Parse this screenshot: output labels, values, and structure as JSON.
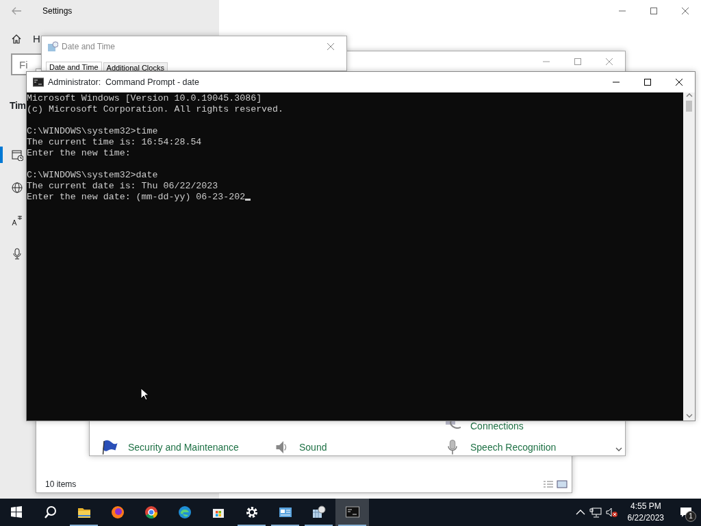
{
  "settings_window": {
    "title": "Settings",
    "home_label": "H",
    "search_placeholder": "Fi",
    "section_heading": "Tim",
    "sidebar_items": [
      {
        "kind": "calendar",
        "selected": true
      },
      {
        "kind": "globe",
        "selected": false
      },
      {
        "kind": "language",
        "selected": false
      },
      {
        "kind": "microphone",
        "selected": false
      }
    ]
  },
  "explorer_window": {
    "status": "10 items"
  },
  "control_panel_window": {
    "rows": [
      [
        null,
        null,
        {
          "label": "Connections",
          "kind": "network"
        }
      ],
      [
        {
          "label": "Security and Maintenance",
          "kind": "flag"
        },
        {
          "label": "Sound",
          "kind": "speaker"
        },
        {
          "label": "Speech Recognition",
          "kind": "microphone"
        }
      ]
    ]
  },
  "date_time_dialog": {
    "title": "Date and Time",
    "tabs": [
      {
        "label": "Date and Time",
        "selected": true
      },
      {
        "label": "Additional Clocks",
        "selected": false
      }
    ]
  },
  "command_prompt": {
    "title": "Administrator:  Command Prompt - date",
    "blocks": [
      [
        "Microsoft Windows [Version 10.0.19045.3086]",
        "(c) Microsoft Corporation. All rights reserved."
      ],
      [
        "C:\\WINDOWS\\system32>time",
        "The current time is: 16:54:28.54",
        "Enter the new time:"
      ],
      [
        "C:\\WINDOWS\\system32>date",
        "The current date is: Thu 06/22/2023",
        "Enter the new date: (mm-dd-yy) 06-23-202"
      ]
    ]
  },
  "taskbar": {
    "apps": [
      {
        "kind": "start",
        "running": false,
        "active": false
      },
      {
        "kind": "search",
        "running": false,
        "active": false
      },
      {
        "kind": "folder",
        "running": true,
        "active": false
      },
      {
        "kind": "firefox",
        "running": false,
        "active": false
      },
      {
        "kind": "chrome",
        "running": false,
        "active": false
      },
      {
        "kind": "edge",
        "running": false,
        "active": false
      },
      {
        "kind": "store",
        "running": false,
        "active": false
      },
      {
        "kind": "gear",
        "running": true,
        "active": false
      },
      {
        "kind": "controlpanel",
        "running": true,
        "active": false
      },
      {
        "kind": "datetime",
        "running": true,
        "active": false
      },
      {
        "kind": "console",
        "running": true,
        "active": true
      }
    ],
    "time": "4:55 PM",
    "date": "6/22/2023",
    "notification_count": "1"
  }
}
